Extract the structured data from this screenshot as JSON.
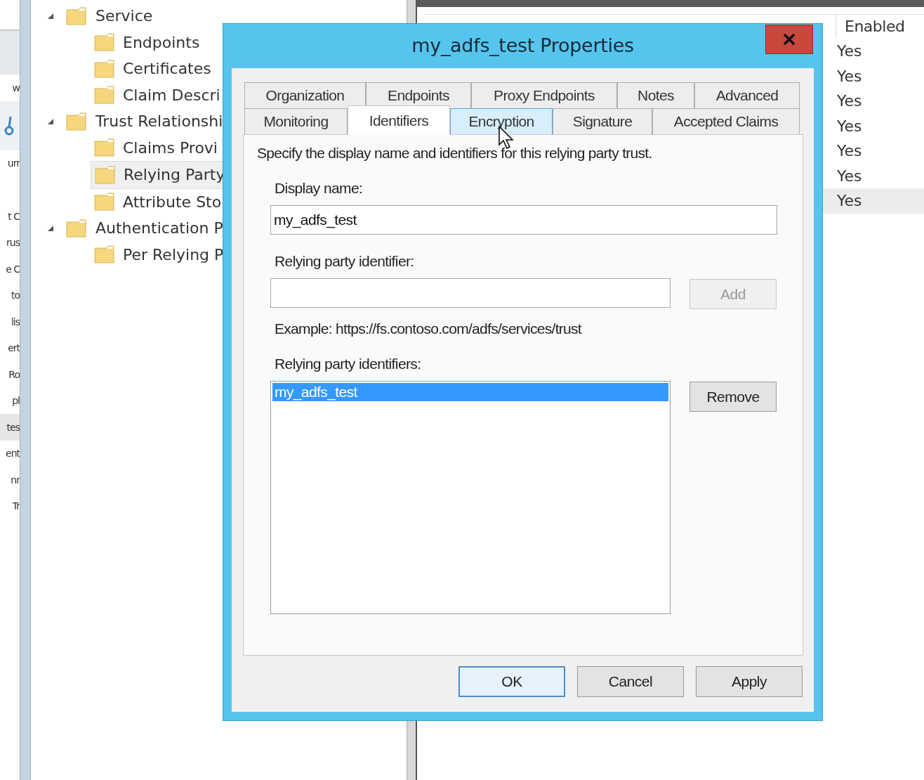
{
  "left_strip": {
    "fragments": [
      {
        "text": "w",
        "selected": false
      },
      {
        "text": "urr",
        "selected": false
      },
      {
        "text": "t C",
        "selected": false
      },
      {
        "text": "rus",
        "selected": false
      },
      {
        "text": "e C",
        "selected": false
      },
      {
        "text": "to",
        "selected": false
      },
      {
        "text": "lis",
        "selected": false
      },
      {
        "text": "ert",
        "selected": false
      },
      {
        "text": "Ro",
        "selected": false
      },
      {
        "text": "pl",
        "selected": false
      },
      {
        "text": "tes",
        "selected": true
      },
      {
        "text": "ent",
        "selected": false
      },
      {
        "text": "nr",
        "selected": false
      },
      {
        "text": "Tr",
        "selected": false
      }
    ]
  },
  "tree": [
    {
      "label": "Service",
      "expanded": true,
      "selected": false,
      "children": [
        {
          "label": "Endpoints",
          "selected": false
        },
        {
          "label": "Certificates",
          "selected": false
        },
        {
          "label": "Claim Descri",
          "selected": false
        }
      ]
    },
    {
      "label": "Trust Relationshi",
      "expanded": true,
      "selected": false,
      "children": [
        {
          "label": "Claims Provi",
          "selected": false
        },
        {
          "label": "Relying Party",
          "selected": true
        },
        {
          "label": "Attribute Sto",
          "selected": false
        }
      ]
    },
    {
      "label": "Authentication P",
      "expanded": true,
      "selected": false,
      "children": [
        {
          "label": "Per Relying P",
          "selected": false
        }
      ]
    }
  ],
  "right_list": {
    "column": "Enabled",
    "rows": [
      {
        "value": "Yes",
        "selected": false
      },
      {
        "value": "Yes",
        "selected": false
      },
      {
        "value": "Yes",
        "selected": false
      },
      {
        "value": "Yes",
        "selected": false
      },
      {
        "value": "Yes",
        "selected": false
      },
      {
        "value": "Yes",
        "selected": false
      },
      {
        "value": "Yes",
        "selected": true
      }
    ]
  },
  "dialog": {
    "title": "my_adfs_test Properties",
    "tab_rows": [
      [
        {
          "label": "Organization",
          "selected": false,
          "hovered": false
        },
        {
          "label": "Endpoints",
          "selected": false,
          "hovered": false
        },
        {
          "label": "Proxy Endpoints",
          "selected": false,
          "hovered": false
        },
        {
          "label": "Notes",
          "selected": false,
          "hovered": false
        },
        {
          "label": "Advanced",
          "selected": false,
          "hovered": false
        }
      ],
      [
        {
          "label": "Monitoring",
          "selected": false,
          "hovered": false
        },
        {
          "label": "Identifiers",
          "selected": true,
          "hovered": false
        },
        {
          "label": "Encryption",
          "selected": false,
          "hovered": true
        },
        {
          "label": "Signature",
          "selected": false,
          "hovered": false
        },
        {
          "label": "Accepted Claims",
          "selected": false,
          "hovered": false
        }
      ]
    ],
    "description": "Specify the display name and identifiers for this relying party trust.",
    "display_name": {
      "label": "Display name:",
      "value": "my_adfs_test"
    },
    "identifier": {
      "label": "Relying party identifier:"
    },
    "add_button": {
      "label": "Add",
      "disabled": true
    },
    "example": "Example: https://fs.contoso.com/adfs/services/trust",
    "identifiers": {
      "label": "Relying party identifiers:",
      "items": [
        {
          "text": "my_adfs_test",
          "selected": true
        }
      ]
    },
    "remove_button": {
      "label": "Remove",
      "disabled": false
    },
    "buttons": [
      {
        "label": "OK",
        "default": true
      },
      {
        "label": "Cancel",
        "default": false
      },
      {
        "label": "Apply",
        "default": false
      }
    ]
  }
}
